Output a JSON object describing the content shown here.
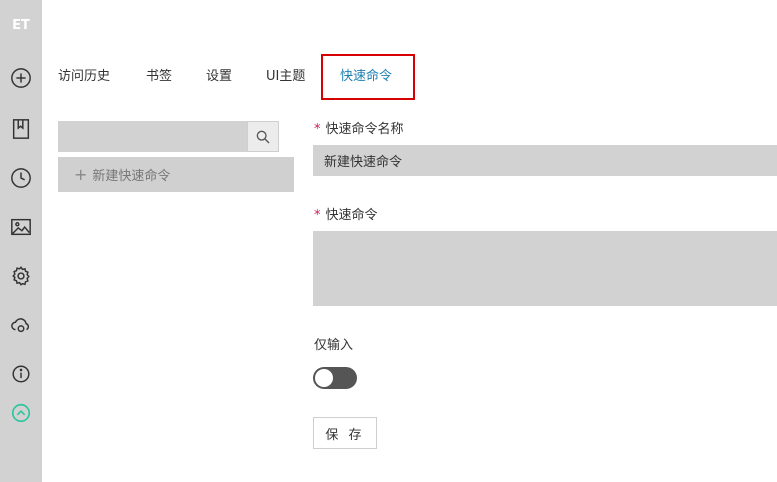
{
  "sidebar": {
    "logo": "ET",
    "icons": [
      "add-icon",
      "bookmark-icon",
      "history-clock-icon",
      "image-icon",
      "gear-icon",
      "cloud-sync-icon",
      "info-icon",
      "collapse-up-icon"
    ],
    "accent": "#2ec4a0"
  },
  "tabs": [
    {
      "label": "访问历史",
      "active": false
    },
    {
      "label": "书签",
      "active": false
    },
    {
      "label": "设置",
      "active": false
    },
    {
      "label": "UI主题",
      "active": false
    },
    {
      "label": "快速命令",
      "active": true
    }
  ],
  "search": {
    "value": "",
    "placeholder": ""
  },
  "list": {
    "new_command_label": "新建快速命令"
  },
  "form": {
    "required_mark": "*",
    "name_label": "快速命令名称",
    "name_value": "新建快速命令",
    "command_label": "快速命令",
    "command_value": "",
    "input_only_label": "仅输入",
    "input_only_enabled": false,
    "save_label": "保 存"
  },
  "colors": {
    "active_tab": "#1d7fb0",
    "highlight_border": "#d60000",
    "required": "#d4145a"
  }
}
